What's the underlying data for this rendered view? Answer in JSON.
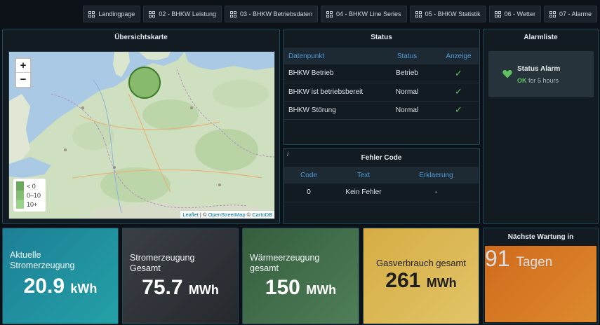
{
  "nav": [
    {
      "label": "Landingpage"
    },
    {
      "label": "02 - BHKW Leistung"
    },
    {
      "label": "03 - BHKW Betriebsdaten"
    },
    {
      "label": "04 - BHKW Line Series"
    },
    {
      "label": "05 - BHKW Statistik"
    },
    {
      "label": "06 - Wetter"
    },
    {
      "label": "07 - Alarme"
    }
  ],
  "map_panel": {
    "title": "Übersichtskarte",
    "zoom_in": "+",
    "zoom_out": "−",
    "legend": [
      {
        "label": "< 0",
        "color": "#6aaa5e"
      },
      {
        "label": "0–10",
        "color": "#82bf74"
      },
      {
        "label": "10+",
        "color": "#9ad38a"
      }
    ],
    "attribution": {
      "leaflet": "Leaflet",
      "sep1": " | © ",
      "osm": "OpenStreetMap",
      "sep2": " © ",
      "carto": "CartoDB"
    }
  },
  "status_panel": {
    "title": "Status",
    "columns": [
      "Datenpunkt",
      "Status",
      "Anzeige"
    ],
    "rows": [
      {
        "datapoint": "BHKW Betrieb",
        "status": "Betrieb"
      },
      {
        "datapoint": "BHKW ist betriebsbereit",
        "status": "Normal"
      },
      {
        "datapoint": "BHKW Störung",
        "status": "Normal"
      }
    ]
  },
  "fehler_panel": {
    "title": "Fehler Code",
    "info": "i",
    "columns": [
      "Code",
      "Text",
      "Erklaerung"
    ],
    "rows": [
      {
        "code": "0",
        "text": "Kein Fehler",
        "erklaerung": "-"
      }
    ]
  },
  "alarm_panel": {
    "title": "Alarmliste",
    "card_title": "Status Alarm",
    "state": "OK",
    "duration": "for 5 hours",
    "ok_color": "#5fc25f"
  },
  "tiles": [
    {
      "label": "Aktuelle Stromerzeugung",
      "value": "20.9",
      "unit": "kWh",
      "color": "#1f8d9a"
    },
    {
      "label": "Stromerzeugung Gesamt",
      "value": "75.7",
      "unit": "MWh",
      "color": "#2b3036"
    },
    {
      "label": "Wärmeerzeugung gesamt",
      "value": "150",
      "unit": "MWh",
      "color": "#3f6a48"
    },
    {
      "label": "Gasverbrauch gesamt",
      "value": "261",
      "unit": "MWh",
      "color": "#d6b14c"
    },
    {
      "title": "Nächste Wartung in",
      "value": "91",
      "unit": "Tagen",
      "color": "#d5731f"
    }
  ]
}
